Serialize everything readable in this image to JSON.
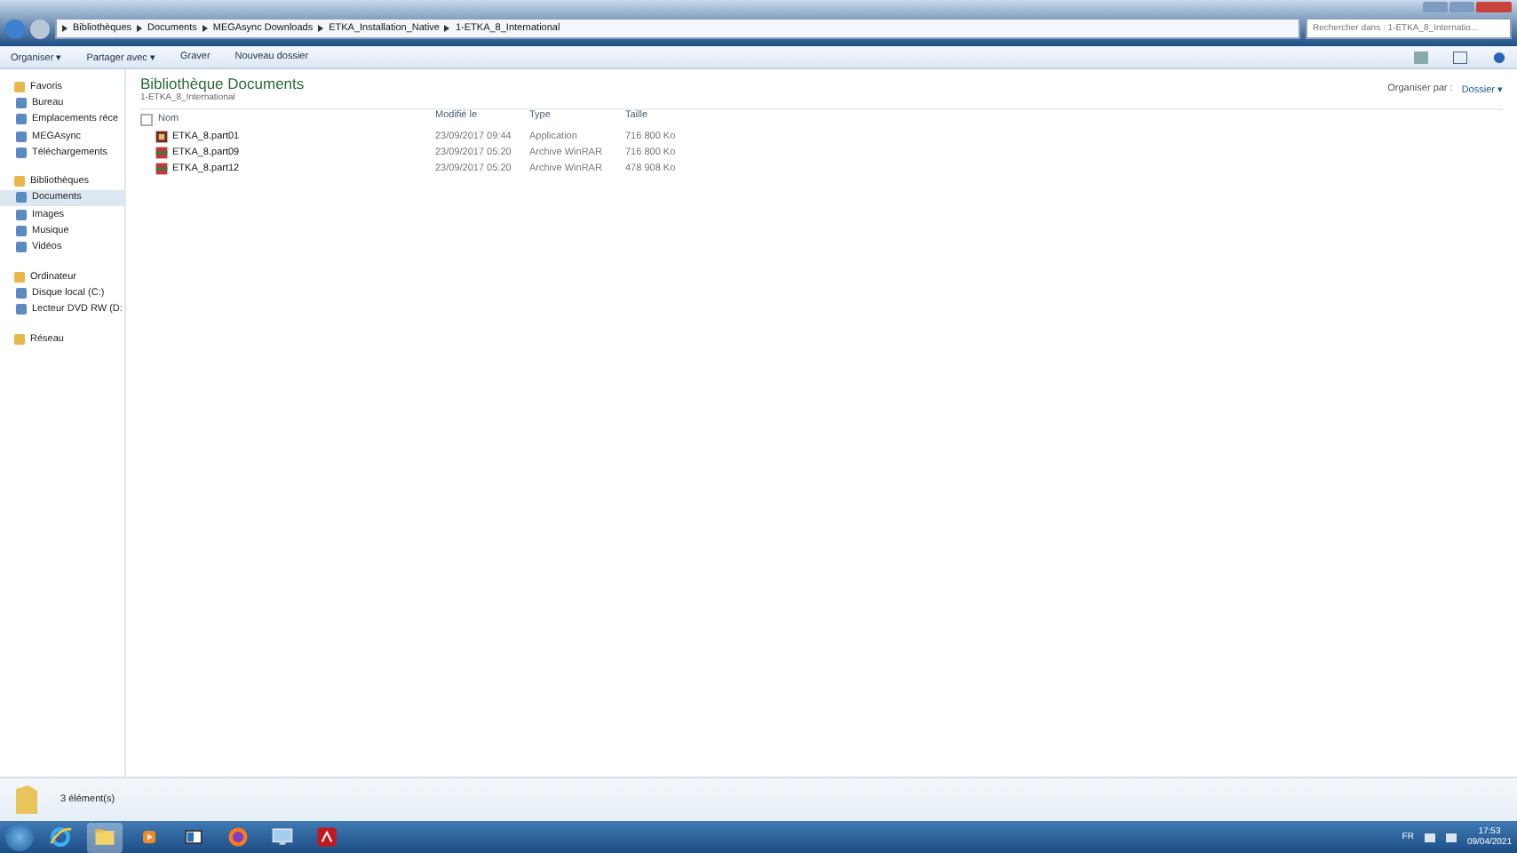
{
  "breadcrumb": [
    "Bibliothèques",
    "Documents",
    "MEGAsync Downloads",
    "ETKA_Installation_Native",
    "1-ETKA_8_International"
  ],
  "search": {
    "placeholder": "Rechercher dans : 1-ETKA_8_Internatio..."
  },
  "toolbar": [
    "Organiser ▾",
    "Partager avec ▾",
    "Graver",
    "Nouveau dossier"
  ],
  "sidebar": [
    {
      "label": "Favoris",
      "selected": false,
      "children": [
        {
          "label": "Bureau",
          "selected": false
        },
        {
          "label": "Emplacements réce",
          "selected": false
        },
        {
          "label": "MEGAsync",
          "selected": false
        },
        {
          "label": "Téléchargements",
          "selected": false
        }
      ]
    },
    {
      "label": "Bibliothèques",
      "selected": false,
      "children": [
        {
          "label": "Documents",
          "selected": true
        },
        {
          "label": "Images",
          "selected": false
        },
        {
          "label": "Musique",
          "selected": false
        },
        {
          "label": "Vidéos",
          "selected": false
        }
      ]
    },
    {
      "label": "Ordinateur",
      "selected": false,
      "children": [
        {
          "label": "Disque local (C:)",
          "selected": false
        },
        {
          "label": "Lecteur DVD RW (D:",
          "selected": false
        }
      ]
    },
    {
      "label": "Réseau",
      "selected": false
    }
  ],
  "library": {
    "title": "Bibliothèque Documents",
    "subtitle": "1-ETKA_8_International",
    "arrange_label": "Organiser par :",
    "arrange_value": "Dossier ▾"
  },
  "table": {
    "select_all_checked": false,
    "columns": [
      "Nom",
      "Modifié le",
      "Type",
      "Taille"
    ],
    "rows": [
      {
        "kind": "app",
        "name": "ETKA_8.part01",
        "modified": "23/09/2017 09:44",
        "type": "Application",
        "size": "716 800 Ko"
      },
      {
        "kind": "rar",
        "name": "ETKA_8.part09",
        "modified": "23/09/2017 05:20",
        "type": "Archive WinRAR",
        "size": "716 800 Ko"
      },
      {
        "kind": "rar",
        "name": "ETKA_8.part12",
        "modified": "23/09/2017 05:20",
        "type": "Archive WinRAR",
        "size": "478 908 Ko"
      }
    ]
  },
  "status_bar": {
    "count": "3 élément(s)"
  },
  "taskbar": {
    "apps": [
      {
        "kind": "ie",
        "selected": false
      },
      {
        "kind": "explorer",
        "selected": true
      },
      {
        "kind": "media",
        "selected": false
      },
      {
        "kind": "window",
        "selected": false
      },
      {
        "kind": "firefox",
        "selected": false
      },
      {
        "kind": "remote",
        "selected": false
      },
      {
        "kind": "pdf",
        "selected": false
      }
    ],
    "lang": "FR",
    "time": "17:53",
    "date": "09/04/2021"
  }
}
